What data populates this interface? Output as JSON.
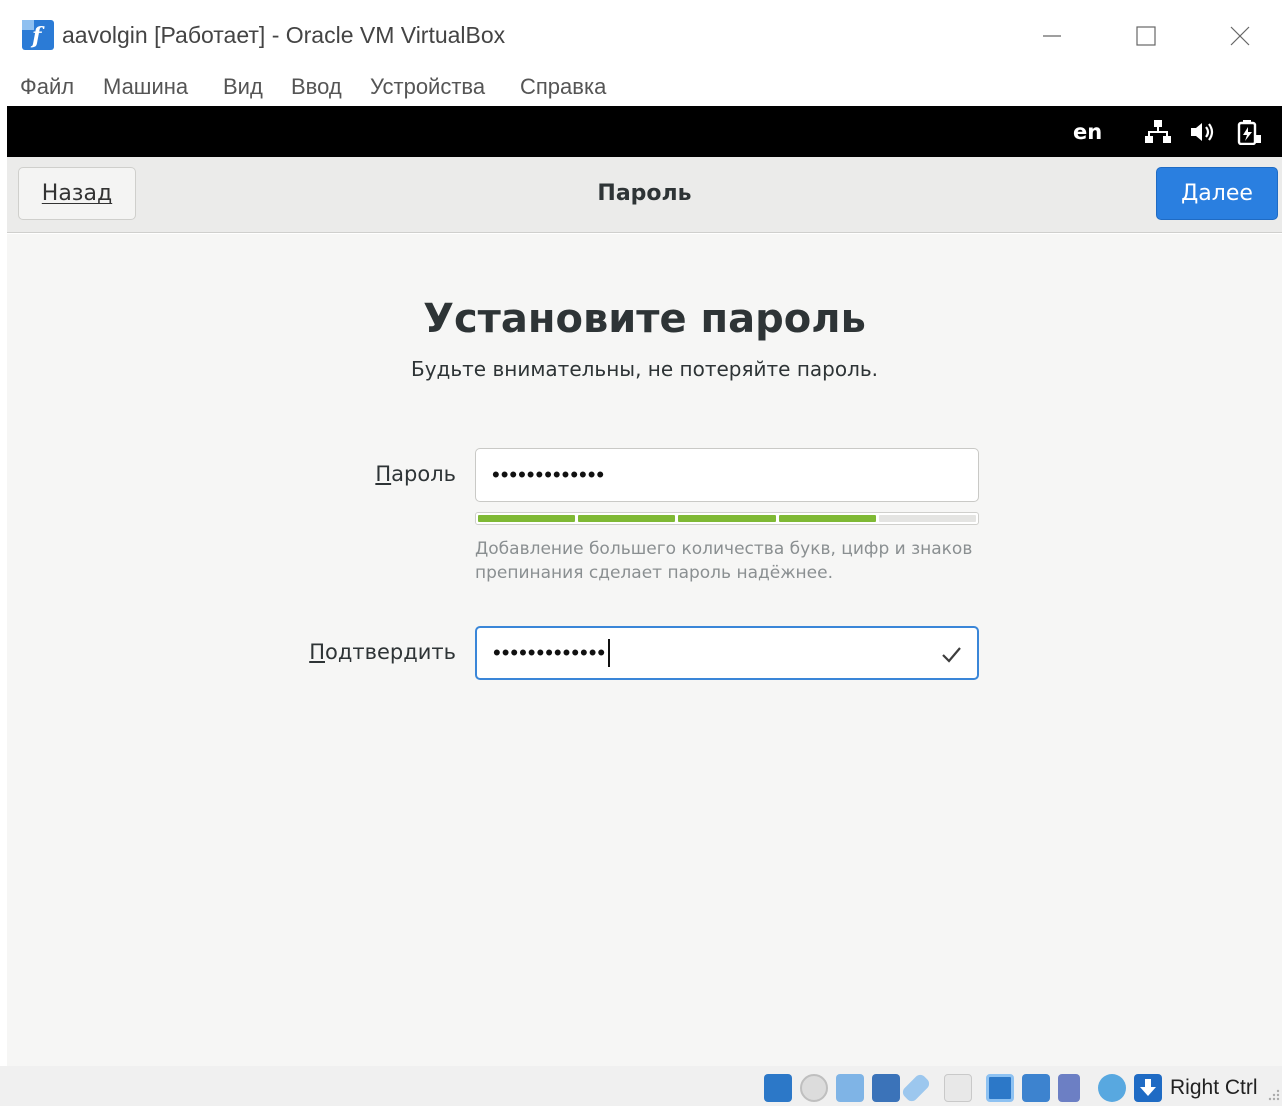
{
  "window": {
    "title": "aavolgin [Работает] - Oracle VM VirtualBox",
    "app_icon": "virtualbox-fedora-icon",
    "controls": [
      "minimize-icon",
      "maximize-icon",
      "close-icon"
    ]
  },
  "menu": {
    "items": [
      {
        "label": "Файл"
      },
      {
        "label": "Машина"
      },
      {
        "label": "Вид"
      },
      {
        "label": "Ввод"
      },
      {
        "label": "Устройства"
      },
      {
        "label": "Справка"
      }
    ]
  },
  "guest_topbar": {
    "keyboard_layout": "en",
    "icons": [
      "network-icon",
      "volume-icon",
      "battery-icon"
    ]
  },
  "header": {
    "back_label": "Назад",
    "title": "Пароль",
    "next_label": "Далее",
    "accent_color": "#2a7fe0"
  },
  "main": {
    "heading": "Установите пароль",
    "subheading": "Будьте внимательны, не потеряйте пароль.",
    "password_label": "Пароль",
    "password_value": "•••••••••••••",
    "strength": {
      "level": 0.8,
      "segments_on": 4,
      "segments_total": 5,
      "color": "#7fb935"
    },
    "hint": "Добавление большего количества букв, цифр и знаков препинания сделает пароль надёжнее.",
    "confirm_label": "Подтвердить",
    "confirm_value": "•••••••••••••",
    "confirm_status_icon": "checkmark-icon"
  },
  "statusbar": {
    "icons": [
      "hdd-icon",
      "optical-drive-icon",
      "audio-icon",
      "network-icon",
      "usb-icon",
      "shared-folders-icon",
      "display-icon",
      "video-capture-icon",
      "vbox-icon",
      "mouse-integration-icon",
      "keyboard-capture-icon"
    ],
    "host_key": "Right Ctrl"
  }
}
